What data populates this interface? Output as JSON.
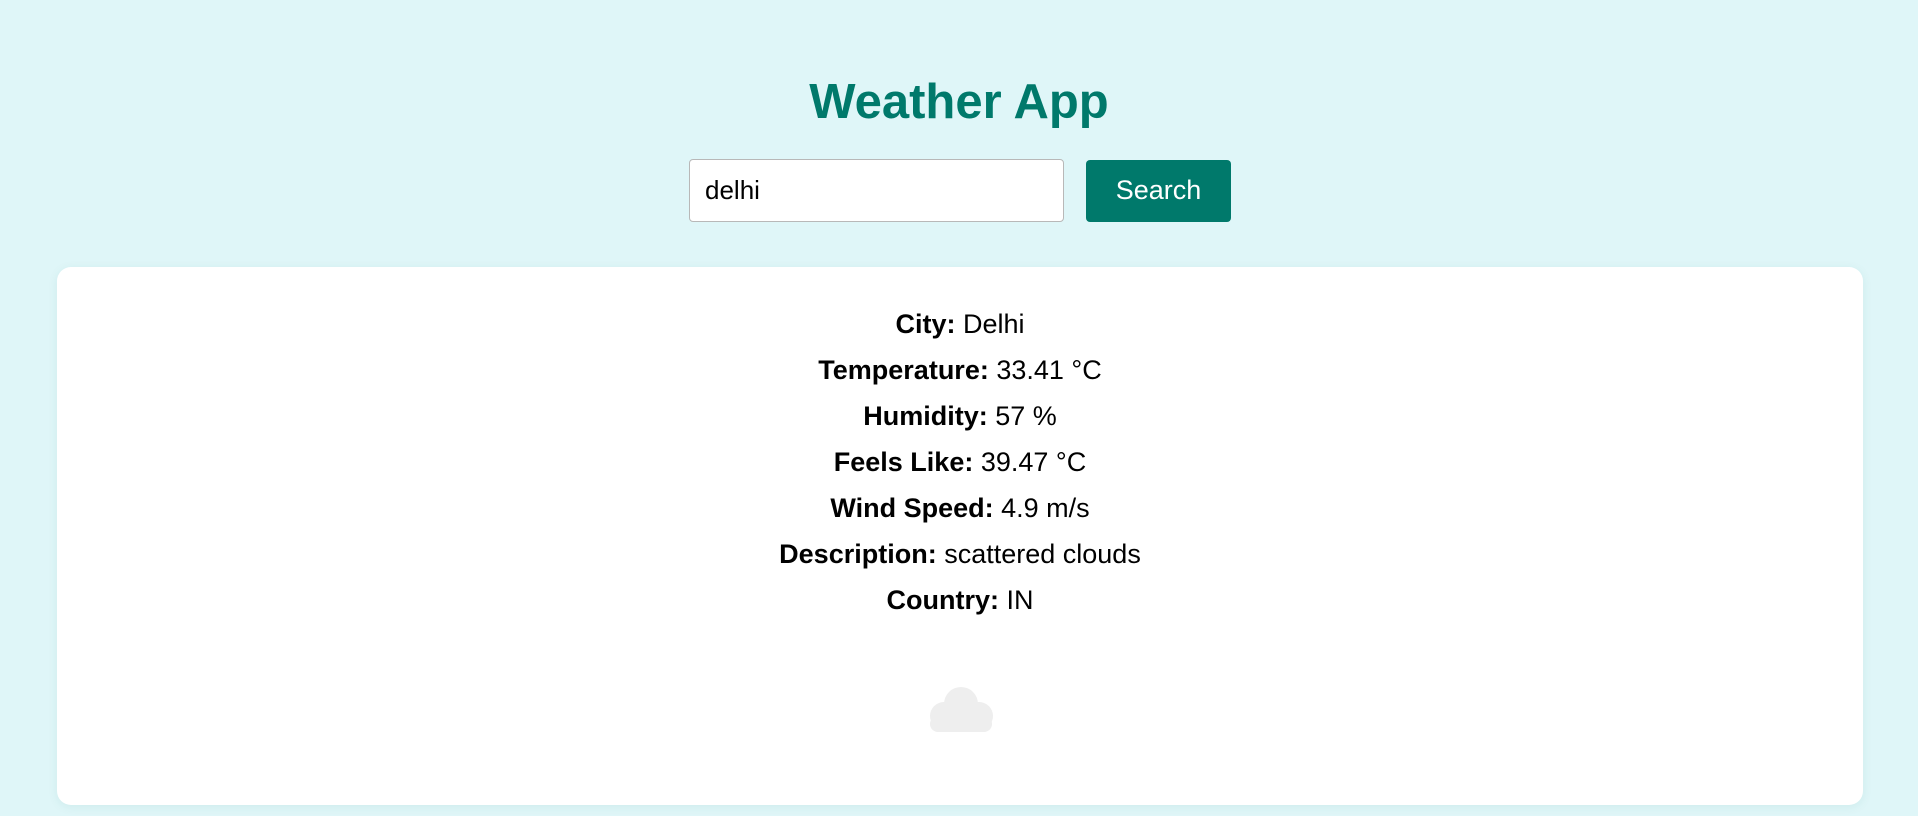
{
  "header": {
    "title": "Weather App"
  },
  "search": {
    "value": "delhi",
    "button_label": "Search"
  },
  "weather": {
    "rows": [
      {
        "label": "City:",
        "value": "Delhi"
      },
      {
        "label": "Temperature:",
        "value": "33.41 °C"
      },
      {
        "label": "Humidity:",
        "value": "57 %"
      },
      {
        "label": "Feels Like:",
        "value": "39.47 °C"
      },
      {
        "label": "Wind Speed:",
        "value": "4.9 m/s"
      },
      {
        "label": "Description:",
        "value": "scattered clouds"
      },
      {
        "label": "Country:",
        "value": "IN"
      }
    ],
    "icon": "cloud-icon"
  },
  "colors": {
    "page_background": "#dff6f8",
    "accent": "#00796b",
    "card_background": "#ffffff",
    "icon_color": "#eeeeee"
  }
}
